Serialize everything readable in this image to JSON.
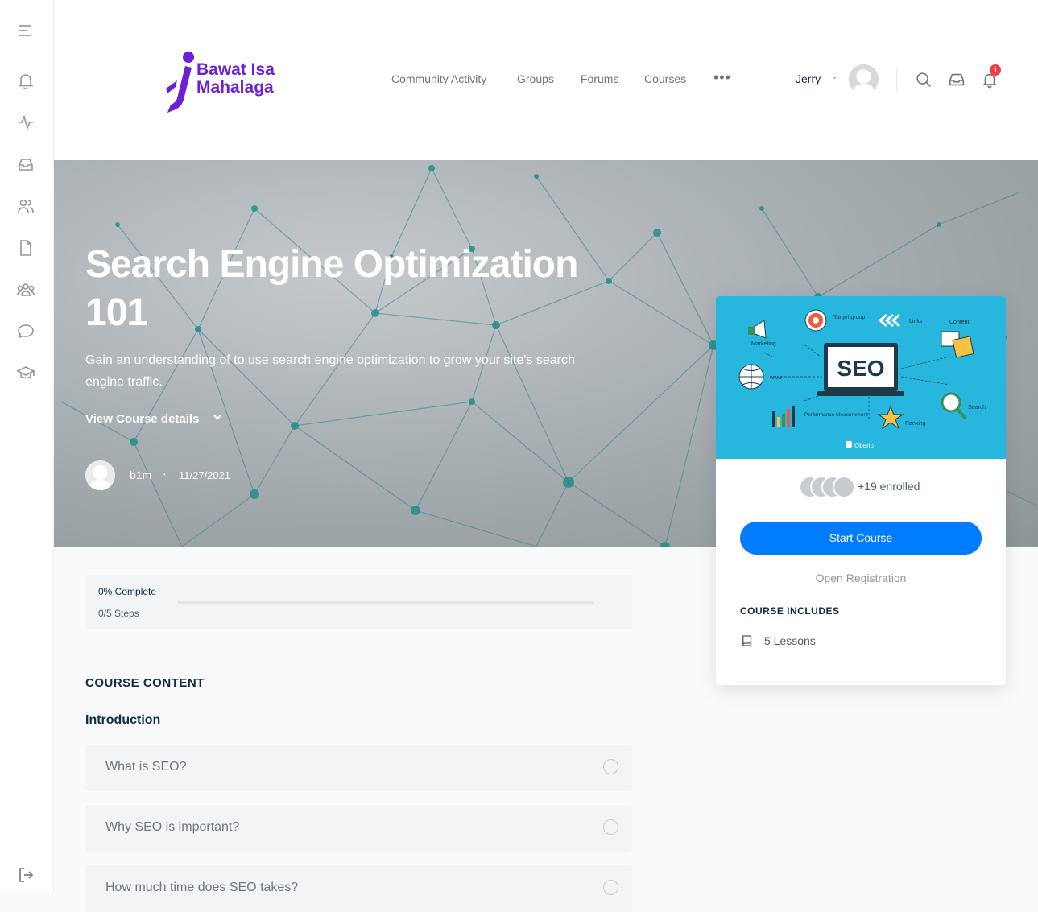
{
  "site": {
    "logo_line1": "Bawat Isa",
    "logo_line2": "Mahalaga"
  },
  "nav": {
    "items": [
      "Community Activity",
      "Groups",
      "Forums",
      "Courses"
    ],
    "more": "•••"
  },
  "user": {
    "name": "Jerry",
    "notifications": "1"
  },
  "hero": {
    "title_line1": "Search Engine Optimization",
    "title_line2": "101",
    "description": "Gain an understanding of to use search engine optimization to grow your site's search engine traffic.",
    "details_link": "View Course details",
    "author": "b1m",
    "separator": "·",
    "date": "11/27/2021"
  },
  "progress": {
    "percent_label": "0% Complete",
    "steps_label": "0/5 Steps",
    "fraction": 0
  },
  "content": {
    "section_title": "COURSE CONTENT",
    "topic": "Introduction",
    "lessons": [
      "What is SEO?",
      "Why SEO is important?",
      "How much time does SEO takes?"
    ]
  },
  "card": {
    "image_labels": {
      "seo": "SEO",
      "target_group": "Target group",
      "links": "Links",
      "content": "Content",
      "marketing": "Marketing",
      "www": "www",
      "search": "Search",
      "performance": "Performance Measurement",
      "ranking": "Ranking",
      "brand": "Oberlo"
    },
    "enrolled": "+19 enrolled",
    "start_button": "Start Course",
    "open_registration": "Open Registration",
    "includes_title": "COURSE INCLUDES",
    "includes_item": "5 Lessons"
  },
  "colors": {
    "accent": "#007cff",
    "logo": "#6c1fd6",
    "badge": "#ef3e46",
    "card_image_bg": "#27b6dd"
  }
}
